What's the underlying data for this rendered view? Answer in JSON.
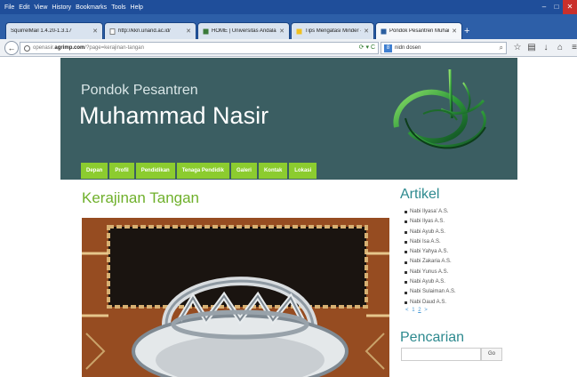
{
  "menubar": {
    "items": [
      "File",
      "Edit",
      "View",
      "History",
      "Bookmarks",
      "Tools",
      "Help"
    ]
  },
  "tabs": [
    {
      "title": "SquirrelMail 1.4.20-1.3.17",
      "icon": "mail-icon"
    },
    {
      "title": "http://kkn.unand.ac.id/",
      "icon": "page-icon"
    },
    {
      "title": "HOME | Universitas Andalas",
      "icon": "page-icon"
    },
    {
      "title": "Tips Mengatasi Minder - A...",
      "icon": "page-icon"
    },
    {
      "title": "Pondok Pesantren Muham...",
      "icon": "site-icon",
      "active": true
    }
  ],
  "navbar": {
    "url_prefix": "openasir.",
    "url_domain": "agrimp.com",
    "url_suffix": "/?page=kerajinan-tangan",
    "search_query": "nidn dosen"
  },
  "site": {
    "subtitle": "Pondok Pesantren",
    "title": "Muhammad Nasir",
    "menu": [
      "Depan",
      "Profil",
      "Pendidikan",
      "Tenaga Pendidik",
      "Galeri",
      "Kontak",
      "Lokasi"
    ]
  },
  "main": {
    "title": "Kerajinan Tangan"
  },
  "sidebar": {
    "articles_title": "Artikel",
    "articles": [
      "Nabi Ilyasa' A.S.",
      "Nabi Ilyas A.S.",
      "Nabi Ayub A.S.",
      "Nabi Isa A.S.",
      "Nabi Yahya A.S.",
      "Nabi Zakaria A.S.",
      "Nabi Yunus A.S.",
      "Nabi Ayub A.S.",
      "Nabi Sulaiman A.S.",
      "Nabi Daud A.S."
    ],
    "pager": {
      "prev": "<",
      "page1": "1",
      "page2": "2",
      "next": ">"
    },
    "search_title": "Pencarian",
    "search_button": "Go"
  },
  "colors": {
    "header_bg": "#3b5e62",
    "menu_bg": "#8ccc2f",
    "title_green": "#6fb02b",
    "sidebar_teal": "#2e8a8f"
  }
}
